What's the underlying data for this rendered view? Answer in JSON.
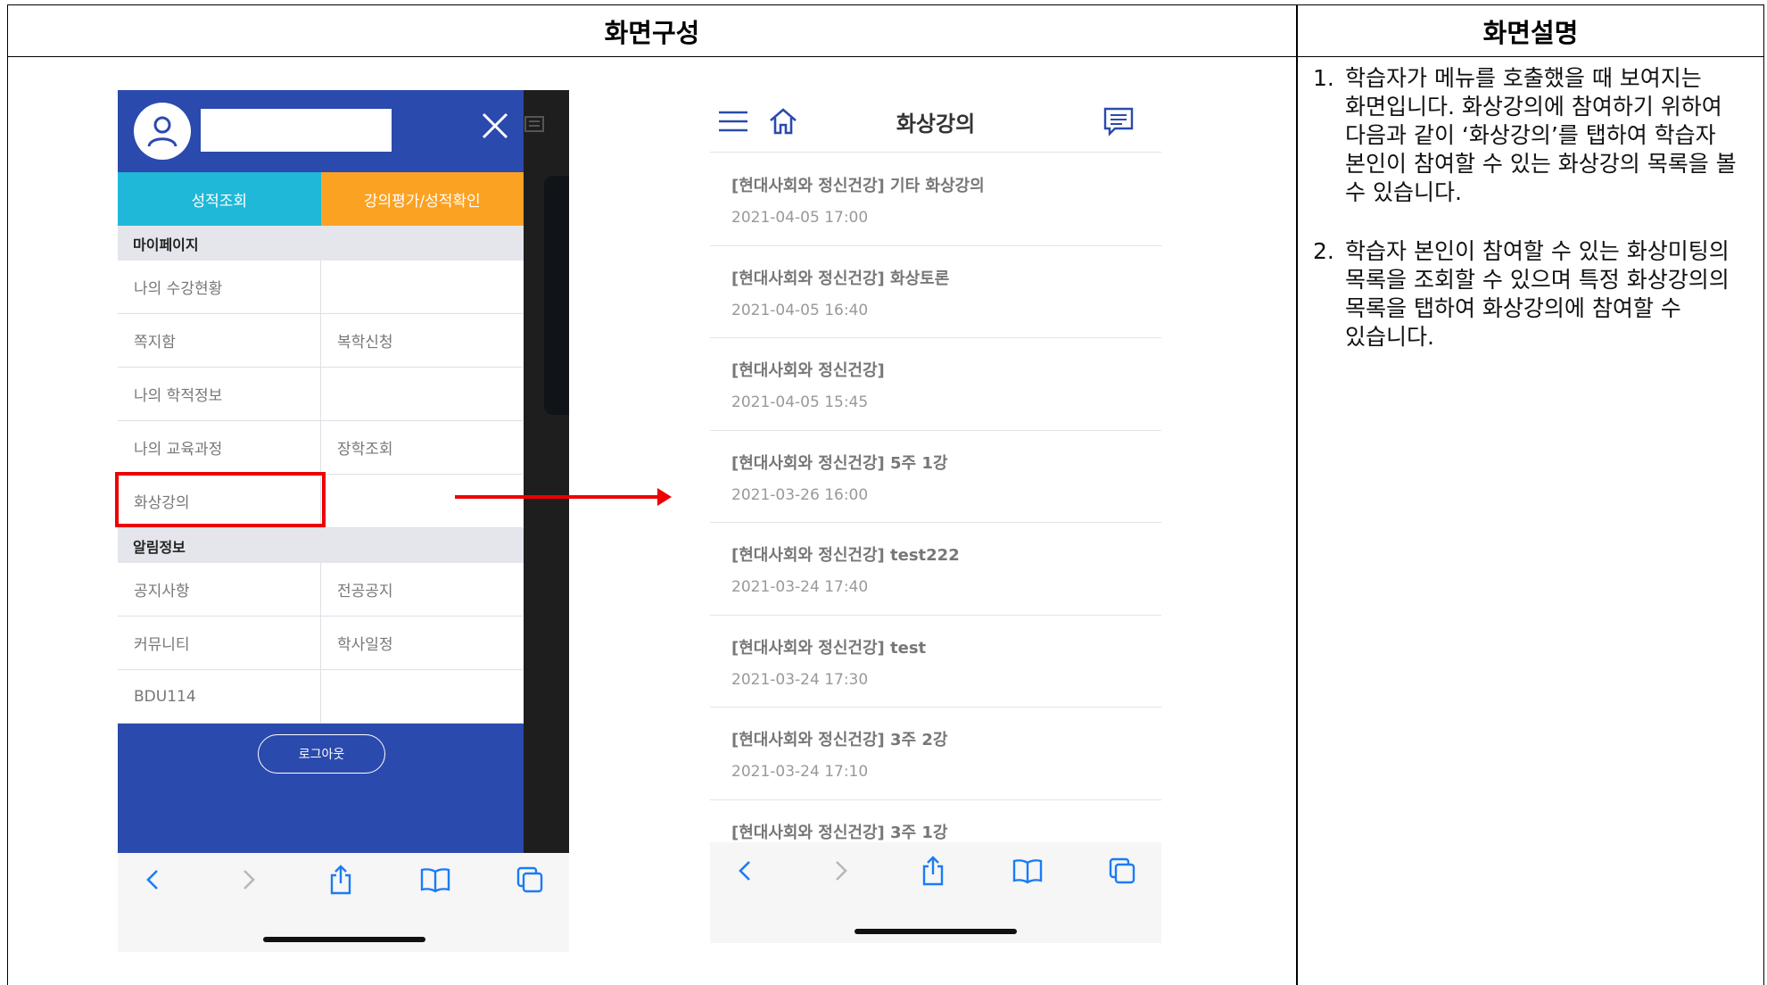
{
  "table": {
    "header_left": "화면구성",
    "header_right": "화면설명"
  },
  "description": [
    {
      "num": "1.",
      "text": "학습자가 메뉴를 호출했을 때 보여지는 화면입니다. 화상강의에 참여하기 위하여 다음과 같이 ‘화상강의’를 탭하여 학습자 본인이 참여할 수 있는 화상강의 목록을 볼 수 있습니다."
    },
    {
      "num": "2.",
      "text": "학습자 본인이 참여할 수 있는 화상미팅의 목록을 조회할 수 있으며 특정 화상강의의 목록을 탭하여 화상강의에 참여할 수 있습니다."
    }
  ],
  "menu": {
    "tabs": [
      "성적조회",
      "강의평가/성적확인"
    ],
    "section_mypage": "마이페이지",
    "mypage_items": [
      "나의 수강현황",
      "",
      "쪽지함",
      "복학신청",
      "나의 학적정보",
      "",
      "나의 교육과정",
      "장학조회",
      "화상강의",
      ""
    ],
    "section_notice": "알림정보",
    "notice_items": [
      "공지사항",
      "전공공지",
      "커뮤니티",
      "학사일정",
      "BDU114",
      ""
    ],
    "logout": "로그아웃"
  },
  "lecture_screen": {
    "title": "화상강의",
    "lectures": [
      {
        "title": "[현대사회와 정신건강] 기타 화상강의",
        "date": "2021-04-05 17:00"
      },
      {
        "title": "[현대사회와 정신건강] 화상토론",
        "date": "2021-04-05 16:40"
      },
      {
        "title": "[현대사회와 정신건강]",
        "date": "2021-04-05 15:45"
      },
      {
        "title": "[현대사회와 정신건강] 5주 1강",
        "date": "2021-03-26 16:00"
      },
      {
        "title": "[현대사회와 정신건강] test222",
        "date": "2021-03-24 17:40"
      },
      {
        "title": "[현대사회와 정신건강] test",
        "date": "2021-03-24 17:30"
      },
      {
        "title": "[현대사회와 정신건강] 3주 2강",
        "date": "2021-03-24 17:10"
      },
      {
        "title": "[현대사회와 정신건강] 3주 1강",
        "date": ""
      }
    ]
  },
  "colors": {
    "menu_bg": "#2b4aad",
    "tab_cyan": "#20b8d8",
    "tab_orange": "#fca223",
    "highlight": "#e00000",
    "icon_blue": "#2b4aad",
    "safari_blue": "#1a7cf5"
  },
  "icons": [
    "user-icon",
    "close-icon",
    "hamburger-icon",
    "home-icon",
    "chat-icon",
    "back-icon",
    "forward-icon",
    "share-icon",
    "bookmarks-icon",
    "tabs-icon"
  ]
}
